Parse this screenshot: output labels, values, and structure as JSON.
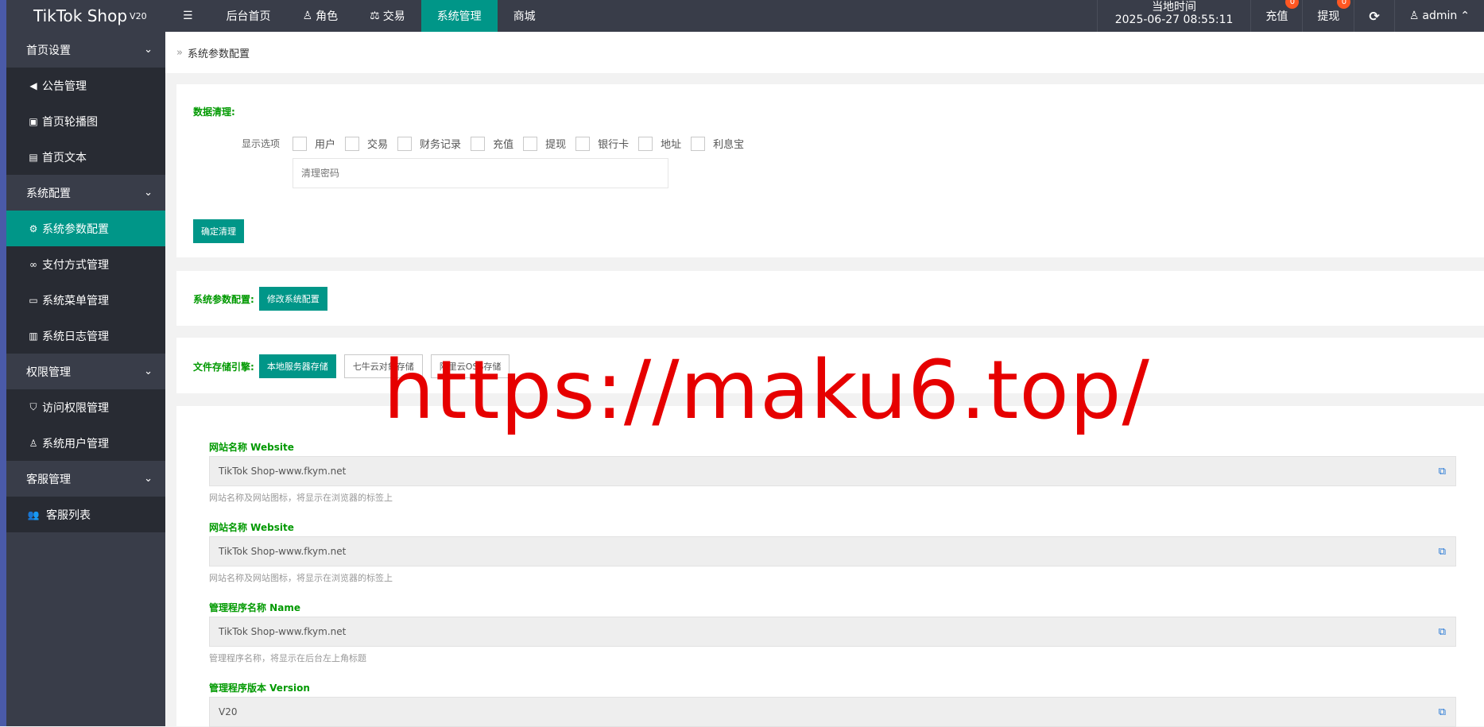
{
  "app": {
    "title": "TikTok Shop",
    "version": "V20"
  },
  "sidebar": {
    "groups": [
      {
        "label": "首页设置",
        "items": [
          {
            "label": "公告管理",
            "icon": "speaker-icon"
          },
          {
            "label": "首页轮播图",
            "icon": "image-icon"
          },
          {
            "label": "首页文本",
            "icon": "file-icon"
          }
        ]
      },
      {
        "label": "系统配置",
        "items": [
          {
            "label": "系统参数配置",
            "icon": "gear-icon"
          },
          {
            "label": "支付方式管理",
            "icon": "link-icon"
          },
          {
            "label": "系统菜单管理",
            "icon": "menu-icon"
          },
          {
            "label": "系统日志管理",
            "icon": "log-icon"
          }
        ]
      },
      {
        "label": "权限管理",
        "items": [
          {
            "label": "访问权限管理",
            "icon": "shield-icon"
          },
          {
            "label": "系统用户管理",
            "icon": "user-icon"
          }
        ]
      },
      {
        "label": "客服管理",
        "items": [
          {
            "label": "客服列表",
            "icon": "users-icon"
          }
        ]
      }
    ]
  },
  "topbar": {
    "menu_toggle": "☰",
    "nav": [
      "后台首页",
      "角色",
      "交易",
      "系统管理",
      "商城"
    ],
    "time_label": "当地时间",
    "time_value": "2025-06-27 08:55:11",
    "recharge": "充值",
    "recharge_badge": "0",
    "withdraw": "提现",
    "withdraw_badge": "0",
    "refresh": "⟳",
    "user": "admin"
  },
  "breadcrumb": "系统参数配置",
  "clean": {
    "title": "数据清理:",
    "options_label": "显示选项",
    "options": [
      "用户",
      "交易",
      "财务记录",
      "充值",
      "提现",
      "银行卡",
      "地址",
      "利息宝"
    ],
    "password_placeholder": "清理密码",
    "confirm_button": "确定清理"
  },
  "sysconfig": {
    "label": "系统参数配置:",
    "button": "修改系统配置"
  },
  "storage": {
    "label": "文件存储引擎:",
    "options": [
      "本地服务器存储",
      "七牛云对象存储",
      "阿里云OSS存储"
    ]
  },
  "fields": [
    {
      "label": "网站名称 Website",
      "value": "TikTok Shop-www.fkym.net",
      "help": "网站名称及网站图标，将显示在浏览器的标签上"
    },
    {
      "label": "网站名称 Website",
      "value": "TikTok Shop-www.fkym.net",
      "help": "网站名称及网站图标，将显示在浏览器的标签上"
    },
    {
      "label": "管理程序名称 Name",
      "value": "TikTok Shop-www.fkym.net",
      "help": "管理程序名称，将显示在后台左上角标题"
    },
    {
      "label": "管理程序版本 Version",
      "value": "V20",
      "help": ""
    }
  ],
  "watermark": "https://maku6.top/"
}
